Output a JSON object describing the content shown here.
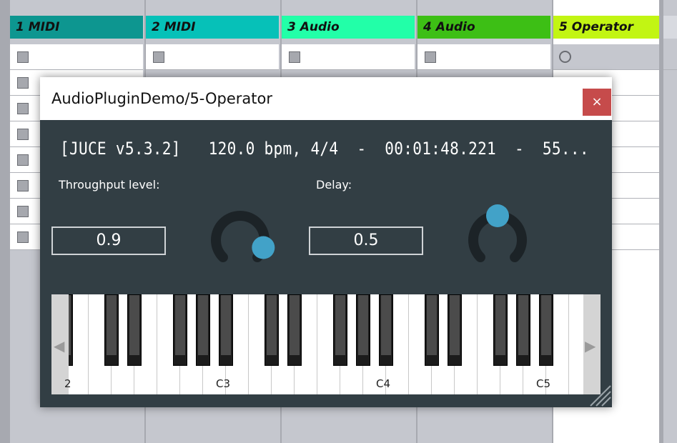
{
  "tracks": [
    {
      "name": "1 MIDI",
      "color": "#0d9690"
    },
    {
      "name": "2 MIDI",
      "color": "#06c1b8"
    },
    {
      "name": "3 Audio",
      "color": "#22ffa8"
    },
    {
      "name": "4 Audio",
      "color": "#3dbf15"
    },
    {
      "name": "5 Operator",
      "color": "#c2f513"
    }
  ],
  "plugin": {
    "title": "AudioPluginDemo/5-Operator",
    "close_label": "×",
    "info": "[JUCE v5.3.2]   120.0 bpm, 4/4  -  00:01:48.221  -  55...",
    "throughput_label": "Throughput level:",
    "throughput_value": "0.9",
    "throughput_fraction": 0.9,
    "delay_label": "Delay:",
    "delay_value": "0.5",
    "delay_fraction": 0.5,
    "knob_color": "#42a2c8",
    "keyboard": {
      "left_arrow": "◀",
      "right_arrow": "▶",
      "labels": [
        "C3",
        "C4",
        "C5"
      ],
      "edge_label": "2"
    }
  }
}
